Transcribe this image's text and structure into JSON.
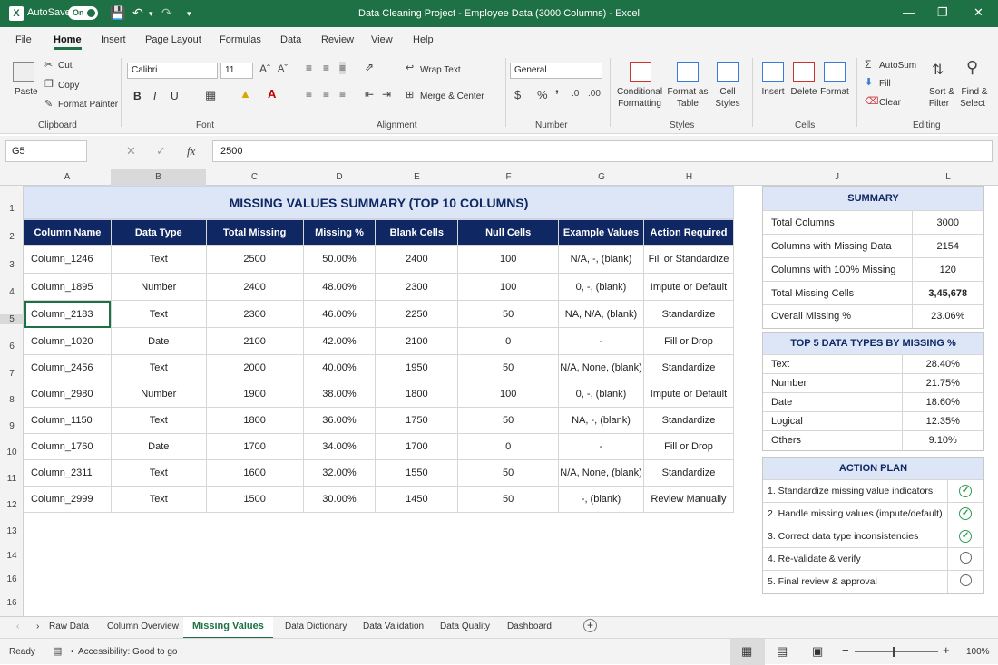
{
  "titlebar": {
    "autosave_label": "AutoSave",
    "autosave_state": "On",
    "title": "Data Cleaning Project - Employee Data (3000 Columns)  -  Excel"
  },
  "menu": [
    "File",
    "Home",
    "Insert",
    "Page Layout",
    "Formulas",
    "Data",
    "Review",
    "View",
    "Help"
  ],
  "ribbon": {
    "paste": "Paste",
    "cut": "Cut",
    "copy": "Copy",
    "format_painter": "Format Painter",
    "clipboard": "Clipboard",
    "font_name": "Calibri",
    "font_size": "11",
    "bold": "B",
    "italic": "I",
    "underline": "U",
    "font": "Font",
    "wrap_text": "Wrap Text",
    "merge_center": "Merge & Center",
    "alignment": "Alignment",
    "number_format": "General",
    "number": "Number",
    "conditional_formatting_1": "Conditional",
    "conditional_formatting_2": "Formatting",
    "format_as_table_1": "Format as",
    "format_as_table_2": "Table",
    "cell_styles_1": "Cell",
    "cell_styles_2": "Styles",
    "styles": "Styles",
    "insert": "Insert",
    "delete": "Delete",
    "format": "Format",
    "cells": "Cells",
    "autosum": "AutoSum",
    "fill": "Fill",
    "clear": "Clear",
    "sort_filter_1": "Sort &",
    "sort_filter_2": "Filter",
    "find_select_1": "Find &",
    "find_select_2": "Select",
    "editing": "Editing"
  },
  "formula_bar": {
    "name_box": "G5",
    "value": "2500"
  },
  "column_headers": [
    "A",
    "B",
    "C",
    "D",
    "E",
    "F",
    "G",
    "H",
    "I",
    "J",
    "L"
  ],
  "row_numbers": [
    "1",
    "2",
    "3",
    "4",
    "5",
    "6",
    "7",
    "8",
    "9",
    "10",
    "11",
    "12",
    "13",
    "14",
    "16",
    "16"
  ],
  "main_table": {
    "title": "MISSING VALUES SUMMARY (TOP 10 COLUMNS)",
    "headers": [
      "Column Name",
      "Data Type",
      "Total Missing",
      "Missing %",
      "Blank Cells",
      "Null Cells",
      "Example Values",
      "Action Required"
    ],
    "rows": [
      [
        "Column_1246",
        "Text",
        "2500",
        "50.00%",
        "2400",
        "100",
        "N/A, -, (blank)",
        "Fill or Standardize"
      ],
      [
        "Column_1895",
        "Number",
        "2400",
        "48.00%",
        "2300",
        "100",
        "0, -, (blank)",
        "Impute or Default"
      ],
      [
        "Column_2183",
        "Text",
        "2300",
        "46.00%",
        "2250",
        "50",
        "NA, N/A, (blank)",
        "Standardize"
      ],
      [
        "Column_1020",
        "Date",
        "2100",
        "42.00%",
        "2100",
        "0",
        "-",
        "Fill or Drop"
      ],
      [
        "Column_2456",
        "Text",
        "2000",
        "40.00%",
        "1950",
        "50",
        "N/A, None, (blank)",
        "Standardize"
      ],
      [
        "Column_2980",
        "Number",
        "1900",
        "38.00%",
        "1800",
        "100",
        "0, -, (blank)",
        "Impute or Default"
      ],
      [
        "Column_1150",
        "Text",
        "1800",
        "36.00%",
        "1750",
        "50",
        "NA, -, (blank)",
        "Standardize"
      ],
      [
        "Column_1760",
        "Date",
        "1700",
        "34.00%",
        "1700",
        "0",
        "-",
        "Fill or Drop"
      ],
      [
        "Column_2311",
        "Text",
        "1600",
        "32.00%",
        "1550",
        "50",
        "N/A, None, (blank)",
        "Standardize"
      ],
      [
        "Column_2999",
        "Text",
        "1500",
        "30.00%",
        "1450",
        "50",
        "-, (blank)",
        "Review Manually"
      ]
    ]
  },
  "summary": {
    "title": "SUMMARY",
    "rows": [
      [
        "Total Columns",
        "3000"
      ],
      [
        "Columns with Missing Data",
        "2154"
      ],
      [
        "Columns with 100% Missing",
        "120"
      ],
      [
        "Total Missing Cells",
        "3,45,678"
      ],
      [
        "Overall Missing %",
        "23.06%"
      ]
    ]
  },
  "top5": {
    "title": "TOP 5 DATA TYPES BY MISSING %",
    "rows": [
      [
        "Text",
        "28.40%"
      ],
      [
        "Number",
        "21.75%"
      ],
      [
        "Date",
        "18.60%"
      ],
      [
        "Logical",
        "12.35%"
      ],
      [
        "Others",
        "9.10%"
      ]
    ]
  },
  "action_plan": {
    "title": "ACTION PLAN",
    "items": [
      {
        "label": "1. Standardize missing value indicators",
        "done": true
      },
      {
        "label": "2. Handle missing values (impute/default)",
        "done": true
      },
      {
        "label": "3. Correct data type inconsistencies",
        "done": true
      },
      {
        "label": "4. Re-validate & verify",
        "done": false
      },
      {
        "label": "5. Final review & approval",
        "done": false
      }
    ]
  },
  "sheet_tabs": [
    "Raw Data",
    "Column Overview",
    "Missing Values",
    "Data Dictionary",
    "Data Validation",
    "Data Quality",
    "Dashboard"
  ],
  "active_tab": "Missing Values",
  "status": {
    "ready": "Ready",
    "accessibility": "Accessibility: Good to go",
    "zoom": "100%"
  }
}
